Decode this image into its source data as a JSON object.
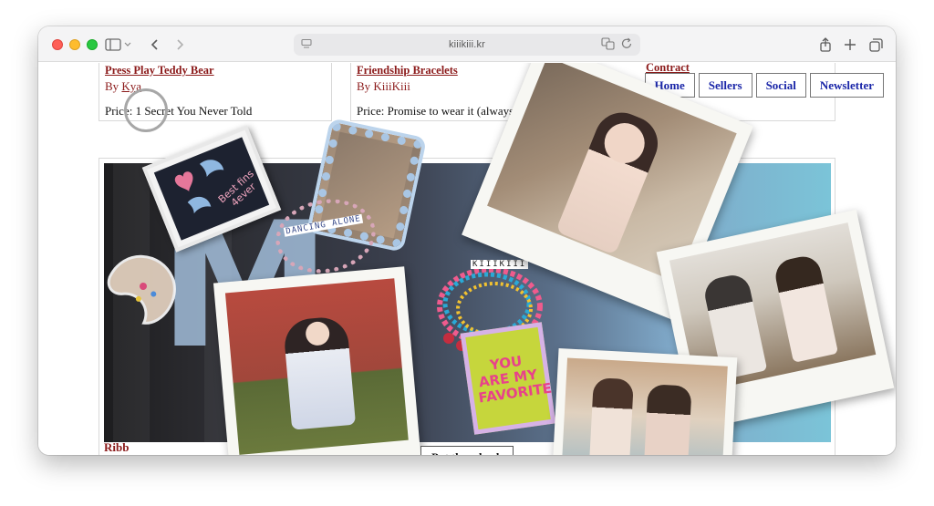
{
  "browser": {
    "url": "kiiikiii.kr",
    "icons": {
      "sidebar": "sidebar-icon",
      "back": "chevron-left-icon",
      "forward": "chevron-right-icon",
      "translate": "translate-icon",
      "reload": "reload-icon",
      "share": "share-icon",
      "new_tab": "plus-icon",
      "tabs": "tab-overview-icon"
    }
  },
  "products": [
    {
      "title": "Press Play Teddy Bear",
      "by_prefix": "By",
      "by_name": "Kya",
      "price": "Price: 1 Secret You Never Told"
    },
    {
      "title": "Friendship Bracelets",
      "by_prefix": "By",
      "by_name": "KiiiKiii",
      "price": "Price: Promise to wear it (always)"
    },
    {
      "title": "Contract"
    }
  ],
  "nav": {
    "home": "Home",
    "sellers": "Sellers",
    "social": "Social",
    "newsletter": "Newsletter"
  },
  "collage": {
    "keychain_text_1": "Best fins",
    "keychain_text_2": "4ever",
    "beads_text": "DANCING ALONE",
    "bracelet_text": "KIIIKIII",
    "badge_text": "YOU ARE MY FAVORITE",
    "put_back_label": "Put them back"
  },
  "colors": {
    "link": "#8b1a1a",
    "nav_text": "#1a26a8"
  }
}
